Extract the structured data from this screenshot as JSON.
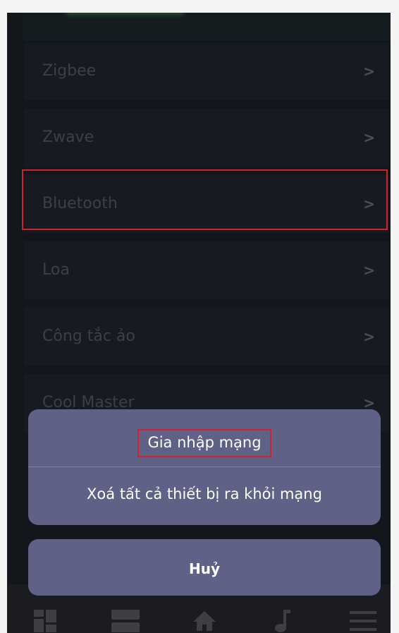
{
  "menu": {
    "items": [
      {
        "label": "Zigbee",
        "chevron": ">"
      },
      {
        "label": "Zwave",
        "chevron": ">"
      },
      {
        "label": "Bluetooth",
        "chevron": ">"
      },
      {
        "label": "Loa",
        "chevron": ">"
      },
      {
        "label": "Công tắc ảo",
        "chevron": ">"
      },
      {
        "label": "Cool Master",
        "chevron": ">"
      }
    ]
  },
  "action_sheet": {
    "options": [
      {
        "label": "Gia nhập mạng"
      },
      {
        "label": "Xoá tất cả thiết bị ra khỏi mạng"
      }
    ],
    "cancel_label": "Huỷ"
  },
  "tabbar": {
    "icons": [
      "dashboard-icon",
      "rooms-icon",
      "home-icon",
      "music-icon",
      "menu-icon"
    ]
  },
  "colors": {
    "sheet_bg": "#5f6186",
    "highlight": "#d1232f",
    "background": "#13171c"
  }
}
